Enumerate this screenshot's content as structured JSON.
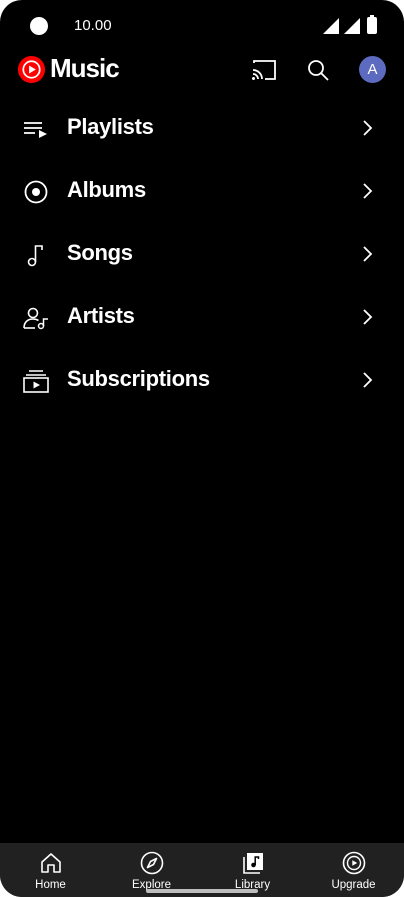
{
  "status_bar": {
    "time": "10.00"
  },
  "app_bar": {
    "logo_text": "Music",
    "avatar_letter": "A",
    "brand_color": "#ff0000",
    "avatar_color": "#5c6bc0"
  },
  "library": {
    "items": [
      {
        "label": "Playlists",
        "icon": "playlist-icon"
      },
      {
        "label": "Albums",
        "icon": "album-icon"
      },
      {
        "label": "Songs",
        "icon": "music-note-icon"
      },
      {
        "label": "Artists",
        "icon": "artist-icon"
      },
      {
        "label": "Subscriptions",
        "icon": "subscriptions-icon"
      }
    ]
  },
  "bottom_nav": {
    "items": [
      {
        "label": "Home",
        "icon": "home-icon"
      },
      {
        "label": "Explore",
        "icon": "compass-icon"
      },
      {
        "label": "Library",
        "icon": "library-icon",
        "selected": true
      },
      {
        "label": "Upgrade",
        "icon": "upgrade-icon"
      }
    ]
  }
}
